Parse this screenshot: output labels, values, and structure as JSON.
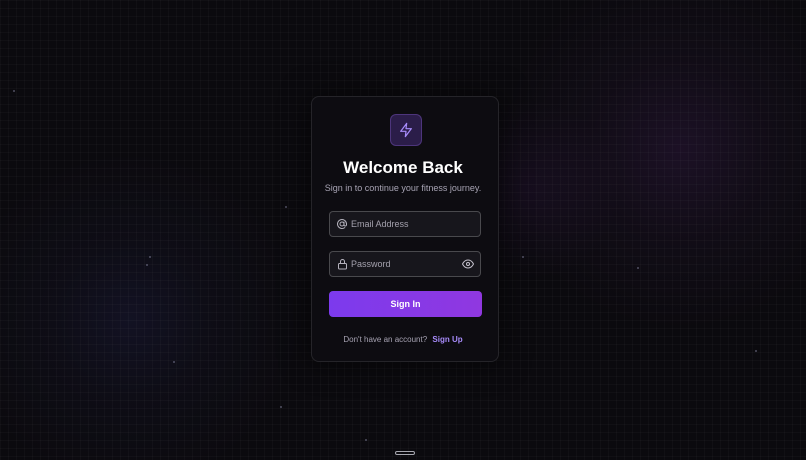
{
  "login": {
    "title": "Welcome Back",
    "subtitle": "Sign in to continue your fitness journey.",
    "email": {
      "placeholder": "Email Address",
      "value": "",
      "icon": "at-sign-icon"
    },
    "password": {
      "placeholder": "Password",
      "value": "",
      "icon": "lock-icon",
      "toggle_icon": "eye-icon"
    },
    "submit_label": "Sign In",
    "footer": {
      "question": "Don't have an account?",
      "signup_label": "Sign Up"
    },
    "logo_icon": "lightning-bolt-icon"
  },
  "colors": {
    "accent": "#7c3aed",
    "accent_light": "#a78bfa",
    "background": "#0b0a0e",
    "card": "#0d0c11"
  }
}
